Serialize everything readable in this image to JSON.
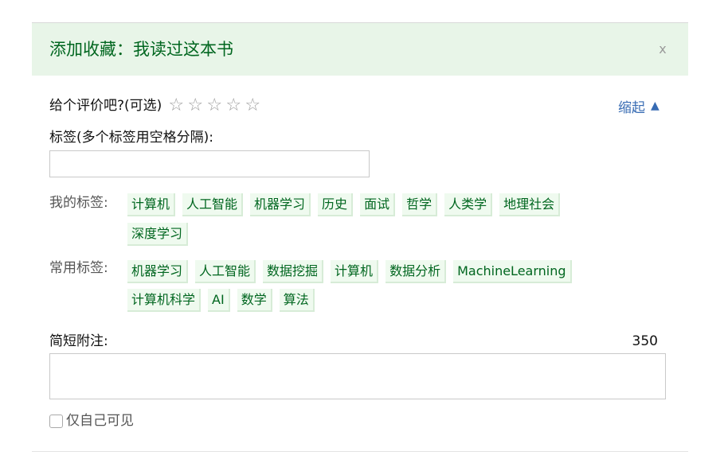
{
  "dialog": {
    "title": "添加收藏：我读过这本书",
    "close_label": "x"
  },
  "rating": {
    "label": "给个评价吧?(可选)",
    "stars": [
      "☆",
      "☆",
      "☆",
      "☆",
      "☆"
    ]
  },
  "collapse": {
    "label": "缩起",
    "icon": "▲"
  },
  "tags_field": {
    "label": "标签(多个标签用空格分隔):",
    "value": "",
    "placeholder": ""
  },
  "my_tags": {
    "label": "我的标签:",
    "items": [
      "计算机",
      "人工智能",
      "机器学习",
      "历史",
      "面试",
      "哲学",
      "人类学",
      "地理社会",
      "深度学习"
    ]
  },
  "common_tags": {
    "label": "常用标签:",
    "items": [
      "机器学习",
      "人工智能",
      "数据挖掘",
      "计算机",
      "数据分析",
      "MachineLearning",
      "计算机科学",
      "AI",
      "数学",
      "算法"
    ]
  },
  "note": {
    "label": "简短附注:",
    "remaining": "350",
    "value": "",
    "placeholder": ""
  },
  "privacy": {
    "label": "仅自己可见",
    "checked": false
  },
  "colors": {
    "header_background": "#e8f5e8",
    "header_text": "#00661f",
    "tag_background": "#effaef",
    "tag_text": "#00661f",
    "link": "#376bb3"
  }
}
